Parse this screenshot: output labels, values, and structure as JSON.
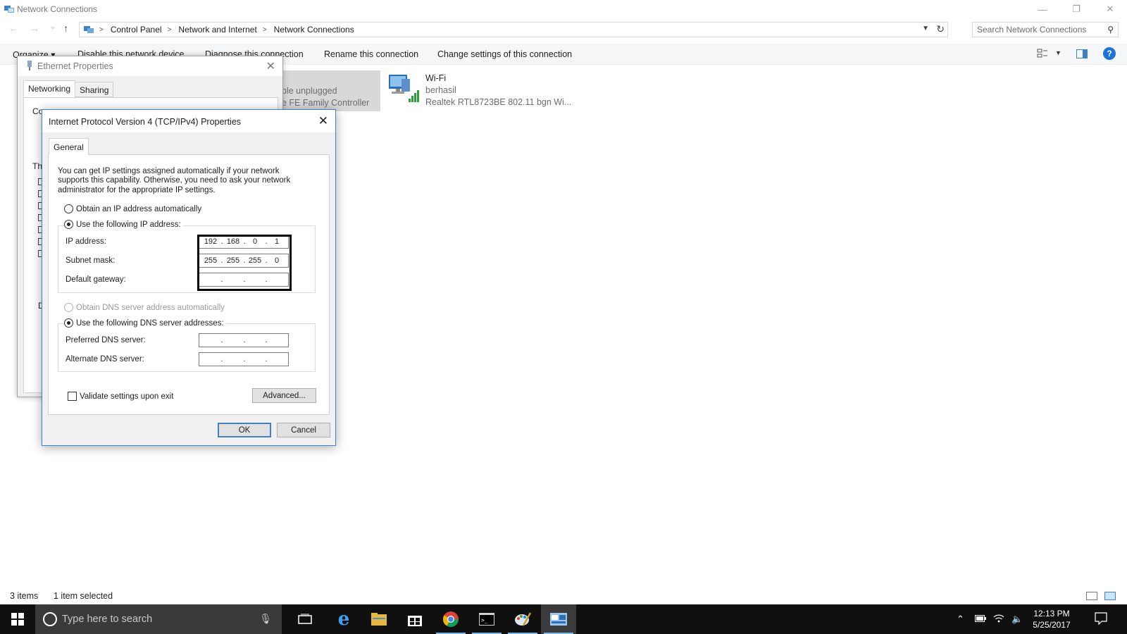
{
  "window": {
    "title": "Network Connections",
    "controls": {
      "minimize": "—",
      "restore": "❐",
      "close": "✕"
    }
  },
  "nav": {
    "back": "←",
    "forward": "→",
    "recent": "⌄",
    "up": "↑",
    "breadcrumb": [
      "Control Panel",
      "Network and Internet",
      "Network Connections"
    ],
    "search_placeholder": "Search Network Connections"
  },
  "commandbar": {
    "items": [
      "Organize ▾",
      "Disable this network device",
      "Diagnose this connection",
      "Rename this connection",
      "Change settings of this connection"
    ]
  },
  "connections": {
    "ethernet_fragment": {
      "line1": "ble unplugged",
      "line2": "e FE Family Controller"
    },
    "wifi": {
      "name": "Wi-Fi",
      "status": "berhasil",
      "device": "Realtek RTL8723BE 802.11 bgn Wi..."
    }
  },
  "statusbar": {
    "items_count": "3 items",
    "selected": "1 item selected"
  },
  "ethernet_dialog": {
    "title": "Ethernet Properties",
    "tabs": [
      "Networking",
      "Sharing"
    ],
    "fragment_connect": "Co",
    "fragment_this": "Th",
    "fragment_d": "D"
  },
  "ipv4_dialog": {
    "title": "Internet Protocol Version 4 (TCP/IPv4) Properties",
    "tab": "General",
    "intro": "You can get IP settings assigned automatically if your network supports this capability. Otherwise, you need to ask your network administrator for the appropriate IP settings.",
    "radio_ip_auto": "Obtain an IP address automatically",
    "radio_ip_manual": "Use the following IP address:",
    "ip_label": "IP address:",
    "ip_value": [
      "192",
      "168",
      "0",
      "1"
    ],
    "subnet_label": "Subnet mask:",
    "subnet_value": [
      "255",
      "255",
      "255",
      "0"
    ],
    "gateway_label": "Default gateway:",
    "radio_dns_auto": "Obtain DNS server address automatically",
    "radio_dns_manual": "Use the following DNS server addresses:",
    "preferred_dns_label": "Preferred DNS server:",
    "alternate_dns_label": "Alternate DNS server:",
    "validate_label": "Validate settings upon exit",
    "advanced_button": "Advanced...",
    "ok_button": "OK",
    "cancel_button": "Cancel",
    "dot": "."
  },
  "taskbar": {
    "search_placeholder": "Type here to search",
    "time": "12:13 PM",
    "date": "5/25/2017"
  },
  "colors": {
    "accent": "#3c82c4",
    "taskbar": "#101010",
    "selection": "#d8d8d8"
  }
}
